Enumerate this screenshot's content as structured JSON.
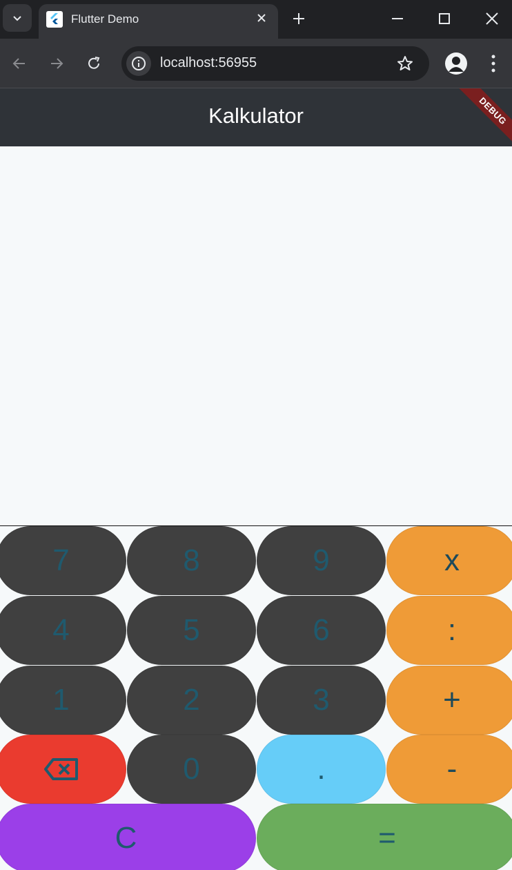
{
  "browser": {
    "tab_title": "Flutter Demo",
    "url": "localhost:56955"
  },
  "app": {
    "title": "Kalkulator",
    "debug_label": "DEBUG",
    "display_value": ""
  },
  "keypad": {
    "k7": "7",
    "k8": "8",
    "k9": "9",
    "mul": "x",
    "k4": "4",
    "k5": "5",
    "k6": "6",
    "div": ":",
    "k1": "1",
    "k2": "2",
    "k3": "3",
    "add": "+",
    "k0": "0",
    "dot": ".",
    "sub": "-",
    "clear": "C",
    "equals": "="
  },
  "colors": {
    "digit_key": "#404040",
    "operator_key": "#ef9b37",
    "backspace_key": "#ea3b2f",
    "dot_key": "#66cdf8",
    "clear_key": "#9b3fe8",
    "equals_key": "#6bad5c",
    "key_text": "#1f5a6e",
    "app_bar": "#2f3338"
  },
  "icons": {
    "backspace": "backspace-icon"
  }
}
